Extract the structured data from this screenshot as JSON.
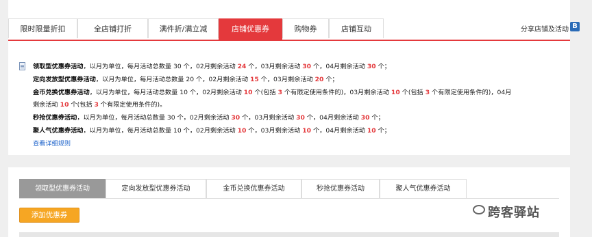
{
  "tabs": [
    {
      "label": "限时限量折扣",
      "active": false
    },
    {
      "label": "全店铺打折",
      "active": false
    },
    {
      "label": "满件折/满立减",
      "active": false
    },
    {
      "label": "店铺优惠券",
      "active": true
    },
    {
      "label": "购物券",
      "active": false
    },
    {
      "label": "店铺互动",
      "active": false
    }
  ],
  "share_link": "分享店铺及活动",
  "share_badge": "B",
  "rules": {
    "l1": {
      "name": "领取型优惠券活动",
      "t1": "，以月为单位，每月活动总数量 30 个，02月剩余活动 ",
      "v1": "24",
      "t2": " 个，03月剩余活动 ",
      "v2": "30",
      "t3": " 个，04月剩余活动 ",
      "v3": "30",
      "t4": " 个；"
    },
    "l2": {
      "name": "定向发放型优惠券活动",
      "t1": "，以月为单位，每月活动总数量 20 个，02月剩余活动 ",
      "v1": "15",
      "t2": " 个，03月剩余活动 ",
      "v2": "20",
      "t3": " 个；"
    },
    "l3": {
      "name": "金币兑换优惠券活动",
      "t1": "，以月为单位，每月活动总数量 10 个，02月剩余活动 ",
      "v1": "10",
      "t2": " 个(包括 ",
      "v2": "3",
      "t3": " 个有限定使用条件的)，03月剩余活动 ",
      "v3": "10",
      "t4": " 个(包括 ",
      "v4": "3",
      "t5": " 个有限定使用条件的)，04月"
    },
    "l3b": {
      "t1": "剩余活动 ",
      "v1": "10",
      "t2": " 个(包括 ",
      "v2": "3",
      "t3": " 个有限定使用条件的)。"
    },
    "l4": {
      "name": "秒抢优惠券活动",
      "t1": "，以月为单位，每月活动总数量 30 个，02月剩余活动 ",
      "v1": "30",
      "t2": " 个，03月剩余活动 ",
      "v2": "30",
      "t3": " 个，04月剩余活动 ",
      "v3": "30",
      "t4": " 个；"
    },
    "l5": {
      "name": "聚人气优惠券活动",
      "t1": "，以月为单位，每月活动总数量 10 个，02月剩余活动 ",
      "v1": "10",
      "t2": " 个，03月剩余活动 ",
      "v2": "10",
      "t3": " 个，04月剩余活动 ",
      "v3": "10",
      "t4": " 个；"
    },
    "detail_link": "查看详细规则"
  },
  "sub_tabs": [
    {
      "label": "领取型优惠券活动",
      "active": true
    },
    {
      "label": "定向发放型优惠券活动",
      "active": false
    },
    {
      "label": "金币兑换优惠券活动",
      "active": false
    },
    {
      "label": "秒抢优惠券活动",
      "active": false
    },
    {
      "label": "聚人气优惠券活动",
      "active": false
    }
  ],
  "add_button": "添加优惠券",
  "watermark": "跨客驿站",
  "colors": {
    "accent_red": "#e4393c",
    "button_orange": "#f6a623",
    "link_blue": "#2266cc"
  }
}
